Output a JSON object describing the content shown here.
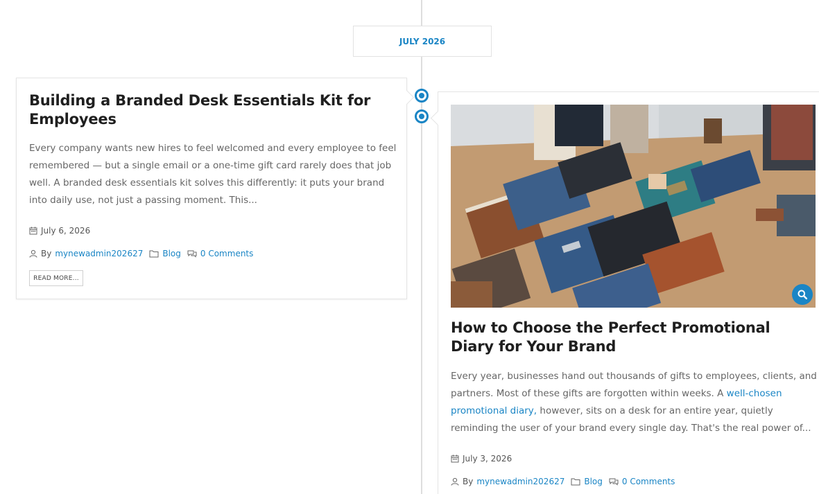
{
  "timeline": {
    "month_label": "JULY 2026"
  },
  "posts": [
    {
      "title": "Building a Branded Desk Essentials Kit for Employees",
      "excerpt": "Every company wants new hires to feel welcomed and every employee to feel remembered — but a single email or a one-time gift card rarely does that job well. A branded desk essentials kit solves this differently: it puts your brand into daily use, not just a passing moment. This...",
      "date": "July 6, 2026",
      "by_label": "By",
      "author": "mynewadmin202627",
      "category": "Blog",
      "comments": "0 Comments",
      "read_more": "READ MORE..."
    },
    {
      "title": "How to Choose the Perfect Promotional Diary for Your Brand",
      "excerpt_part1": "Every year, businesses hand out thousands of gifts to employees, clients, and partners. Most of these gifts are forgotten within weeks. A ",
      "excerpt_link": "well-chosen promotional diary,",
      "excerpt_part2": " however, sits on a desk for an entire year, quietly reminding the user of your brand every single day. That's the real power of...",
      "date": "July 3, 2026",
      "by_label": "By",
      "author": "mynewadmin202627",
      "category": "Blog",
      "comments": "0 Comments",
      "image_icon": "magnifier-icon"
    }
  ],
  "colors": {
    "accent": "#1a85c5",
    "title": "#1f1f1f",
    "text": "#666666",
    "line": "#dedede"
  }
}
